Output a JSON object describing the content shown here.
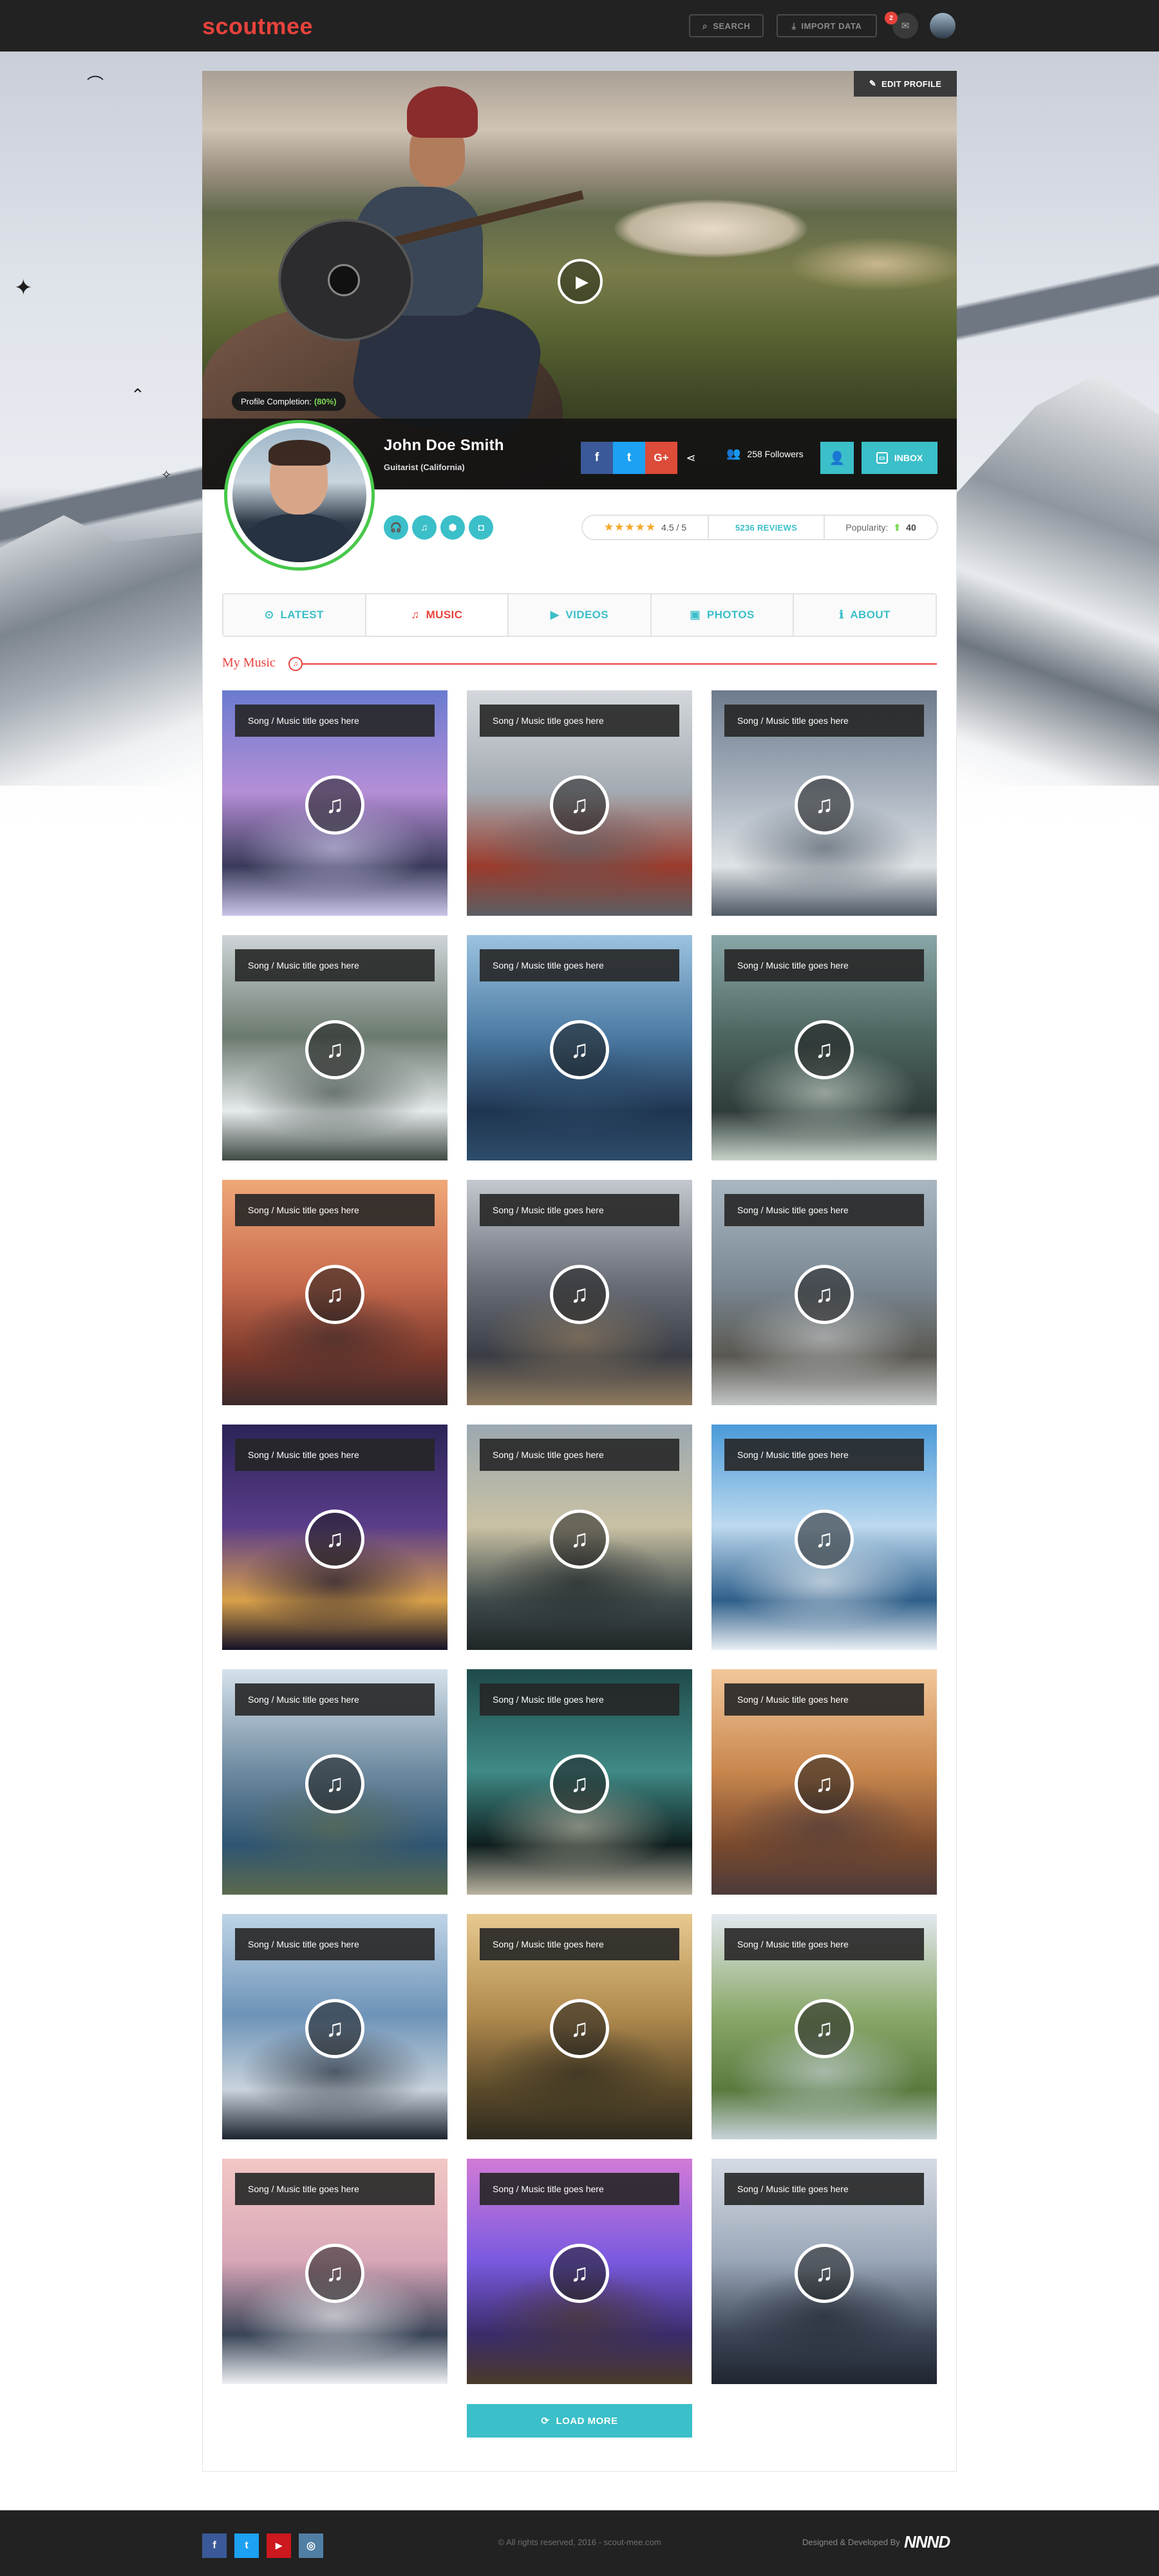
{
  "brand": {
    "logo": "scoutmee",
    "accent": "#e8423c",
    "teal": "#3bbfc9",
    "green": "#47c84a"
  },
  "nav": {
    "search": {
      "label": "SEARCH",
      "icon": "search-icon"
    },
    "import": {
      "label": "IMPORT DATA",
      "icon": "download-icon"
    },
    "mail": {
      "icon": "envelope-icon",
      "badge": "2"
    },
    "user": {
      "icon": "avatar"
    }
  },
  "profile": {
    "edit_label": "EDIT PROFILE",
    "completion_label": "Profile Completion:",
    "completion_value": "(80%)",
    "name": "John Doe Smith",
    "role": "Guitarist (California)",
    "followers": "258 Followers",
    "inbox_label": "INBOX",
    "social": [
      "f",
      "t",
      "G+"
    ],
    "mini_icons": [
      "headphones-icon",
      "music-icon",
      "android-icon",
      "gamepad-icon"
    ],
    "rating_stars": "★★★★★",
    "rating_value": "4.5 / 5",
    "reviews": "5236 REVIEWS",
    "popularity_label": "Popularity:",
    "popularity_icon": "⬆",
    "popularity_value": "40"
  },
  "tabs": [
    {
      "label": "LATEST",
      "icon": "⊙"
    },
    {
      "label": "MUSIC",
      "icon": "♫"
    },
    {
      "label": "VIDEOS",
      "icon": "▶"
    },
    {
      "label": "PHOTOS",
      "icon": "▣"
    },
    {
      "label": "ABOUT",
      "icon": "ℹ"
    }
  ],
  "section": {
    "title": "My Music"
  },
  "music": {
    "items": [
      {
        "title": "Song / Music title goes here",
        "scene": "volcano-clouds",
        "palette": [
          "#6a7bd0",
          "#b58ed6",
          "#3a3b5a",
          "#c9c4e6"
        ]
      },
      {
        "title": "Song / Music title goes here",
        "scene": "golden-gate-bridge",
        "palette": [
          "#d4d8dc",
          "#a3aab1",
          "#9a3b2c",
          "#5b5e63"
        ]
      },
      {
        "title": "Song / Music title goes here",
        "scene": "swans-lake",
        "palette": [
          "#6d7b8c",
          "#a9b3bf",
          "#dfe3e6",
          "#4f5a66"
        ]
      },
      {
        "title": "Song / Music title goes here",
        "scene": "mountain-fog",
        "palette": [
          "#cfd5d9",
          "#6b7a6f",
          "#e6eaec",
          "#3e4a44"
        ]
      },
      {
        "title": "Song / Music title goes here",
        "scene": "ocean-surfer",
        "palette": [
          "#9cc3e0",
          "#4b7aa3",
          "#1f3550",
          "#2d4d6b"
        ]
      },
      {
        "title": "Song / Music title goes here",
        "scene": "foggy-railway",
        "palette": [
          "#8aa7a8",
          "#4d6560",
          "#2f3c3a",
          "#c5d2c8"
        ]
      },
      {
        "title": "Song / Music title goes here",
        "scene": "bridge-sunset",
        "palette": [
          "#f0a878",
          "#c96b4e",
          "#7c3a2c",
          "#3c2a2b"
        ]
      },
      {
        "title": "Song / Music title goes here",
        "scene": "city-traffic",
        "palette": [
          "#c4c8cf",
          "#6b6f78",
          "#3a3d45",
          "#8e7a5e"
        ]
      },
      {
        "title": "Song / Music title goes here",
        "scene": "man-on-wall",
        "palette": [
          "#a9b7c2",
          "#7c8a96",
          "#5a5852",
          "#c3c6c6"
        ]
      },
      {
        "title": "Song / Music title goes here",
        "scene": "night-skyline",
        "palette": [
          "#2b2457",
          "#5a3d8a",
          "#d8a04a",
          "#141228"
        ]
      },
      {
        "title": "Song / Music title goes here",
        "scene": "beach-sunset",
        "palette": [
          "#9ba8b0",
          "#c9c1a4",
          "#3f4a4b",
          "#1f2628"
        ]
      },
      {
        "title": "Song / Music title goes here",
        "scene": "blue-sea",
        "palette": [
          "#4a9ad8",
          "#bcd9ef",
          "#2f5f8a",
          "#e8eef3"
        ]
      },
      {
        "title": "Song / Music title goes here",
        "scene": "fjord",
        "palette": [
          "#d6e2ec",
          "#6e8aa0",
          "#2f5572",
          "#5b6a4e"
        ]
      },
      {
        "title": "Song / Music title goes here",
        "scene": "escalator",
        "palette": [
          "#1f4a4a",
          "#3f8a86",
          "#0f1f1f",
          "#b9b2a0"
        ]
      },
      {
        "title": "Song / Music title goes here",
        "scene": "desert-man",
        "palette": [
          "#f2c79a",
          "#c9874e",
          "#7a4a2e",
          "#4b3a3a"
        ]
      },
      {
        "title": "Song / Music title goes here",
        "scene": "lake-man",
        "palette": [
          "#bfd4e6",
          "#6d93b8",
          "#c9d3dc",
          "#1c2430"
        ]
      },
      {
        "title": "Song / Music title goes here",
        "scene": "swing-field",
        "palette": [
          "#e7c98f",
          "#b08a4e",
          "#5a4a2a",
          "#2f2a1e"
        ]
      },
      {
        "title": "Song / Music title goes here",
        "scene": "green-hills",
        "palette": [
          "#e3e8ee",
          "#8aa86a",
          "#5a7a3e",
          "#c7d3da"
        ]
      },
      {
        "title": "Song / Music title goes here",
        "scene": "matterhorn",
        "palette": [
          "#f2c7c4",
          "#d9a7b8",
          "#3a4558",
          "#eef0f3"
        ]
      },
      {
        "title": "Song / Music title goes here",
        "scene": "pier-purple",
        "palette": [
          "#d27ad6",
          "#7a5ae0",
          "#3a2c6a",
          "#4a3a2a"
        ]
      },
      {
        "title": "Song / Music title goes here",
        "scene": "rocky-coast",
        "palette": [
          "#d6dbe3",
          "#9aa7b8",
          "#3c4656",
          "#1f2530"
        ]
      }
    ]
  },
  "load_more": {
    "label": "LOAD MORE",
    "icon": "⟳"
  },
  "footer": {
    "social": [
      "f",
      "t",
      "▶",
      "◎"
    ],
    "copyright": "© All rights reserved, 2016 - scout-mee.com",
    "designed_by": "Designed & Developed By",
    "dev_logo": "NNND"
  }
}
